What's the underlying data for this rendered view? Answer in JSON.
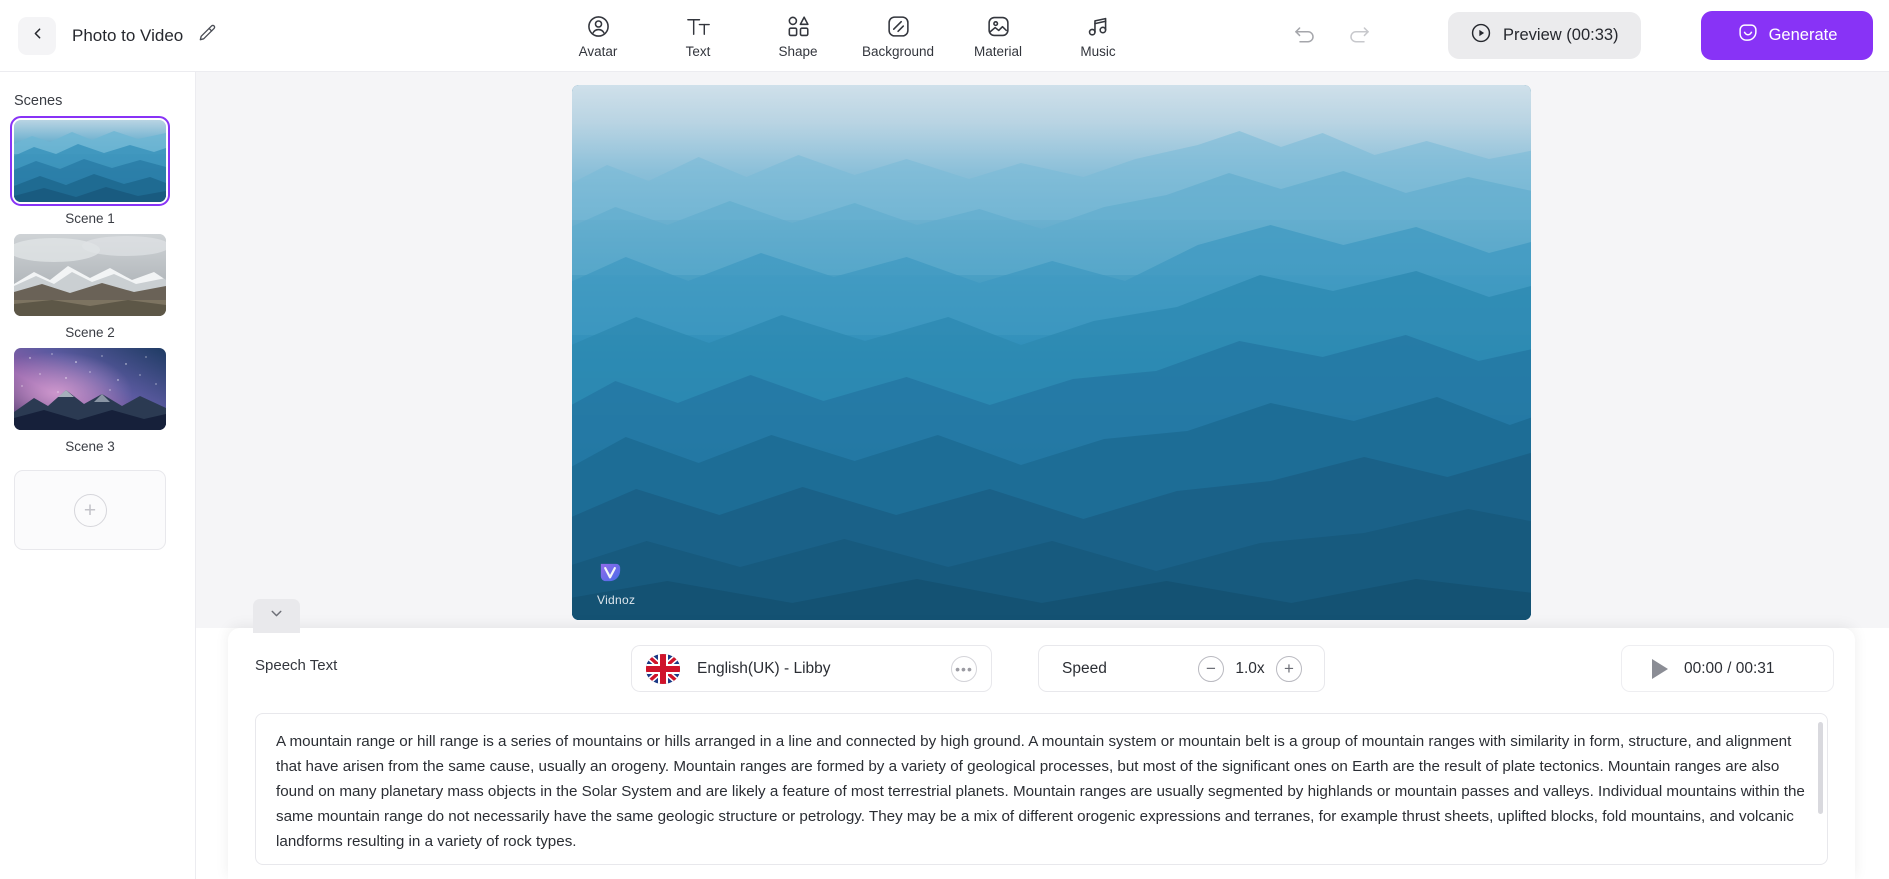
{
  "app": {
    "accent_color": "#8833f6",
    "topbar": {
      "back_icon": "chevron-left-icon",
      "project_title": "Photo to Video",
      "edit_icon": "pencil-icon",
      "tools": [
        {
          "id": "avatar",
          "label": "Avatar",
          "icon": "avatar-icon"
        },
        {
          "id": "text",
          "label": "Text",
          "icon": "text-icon"
        },
        {
          "id": "shape",
          "label": "Shape",
          "icon": "shape-icon"
        },
        {
          "id": "background",
          "label": "Background",
          "icon": "background-icon"
        },
        {
          "id": "material",
          "label": "Material",
          "icon": "material-image-icon"
        },
        {
          "id": "music",
          "label": "Music",
          "icon": "music-note-icon"
        }
      ],
      "undo_icon": "undo-icon",
      "redo_icon": "redo-icon",
      "preview_label": "Preview (00:33)",
      "preview_icon": "play-circle-icon",
      "generate_label": "Generate",
      "generate_icon": "sparkle-video-icon"
    },
    "sidebar": {
      "title": "Scenes",
      "scenes": [
        {
          "caption": "Scene 1",
          "selected": true,
          "thumb": "blue-misty-mountains"
        },
        {
          "caption": "Scene 2",
          "selected": false,
          "thumb": "snowy-mountain-range"
        },
        {
          "caption": "Scene 3",
          "selected": false,
          "thumb": "starry-night-mountains"
        }
      ],
      "add_scene_icon": "plus-icon"
    },
    "canvas": {
      "collapse_icon": "chevron-down-icon",
      "watermark_text": "Vidnoz",
      "watermark_icon": "vidnoz-logo-icon"
    },
    "bottom": {
      "speech_text_label": "Speech Text",
      "voice": {
        "flag_icon": "uk-flag-icon",
        "name": "English(UK) - Libby",
        "more_icon": "more-options-icon"
      },
      "speed": {
        "label": "Speed",
        "minus_icon": "minus-circle-icon",
        "value": "1.0x",
        "plus_icon": "plus-circle-icon"
      },
      "player": {
        "play_icon": "play-icon",
        "time": "00:00 / 00:31"
      },
      "speech_text": "A mountain range or hill range is a series of mountains or hills arranged in a line and connected by high ground. A mountain system or mountain belt is a group of mountain ranges with similarity in form, structure, and alignment that have arisen from the same cause, usually an orogeny. Mountain ranges are formed by a variety of geological processes, but most of the significant ones on Earth are the result of plate tectonics. Mountain ranges are also found on many planetary mass objects in the Solar System and are likely a feature of most terrestrial planets. Mountain ranges are usually segmented by highlands or mountain passes and valleys. Individual mountains within the same mountain range do not necessarily have the same geologic structure or petrology. They may be a mix of different orogenic expressions and terranes, for example thrust sheets, uplifted blocks, fold mountains, and volcanic landforms resulting in a variety of rock types."
    }
  }
}
